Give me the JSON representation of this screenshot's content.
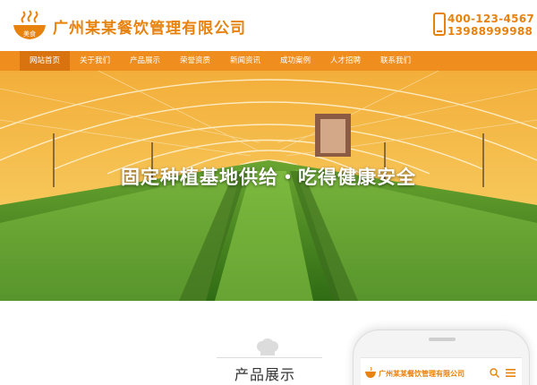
{
  "header": {
    "brand": "广州某某餐饮管理有限公司",
    "logo_caption": "美食",
    "phone": "400-123-4567",
    "mobile": "13988999988"
  },
  "nav": {
    "items": [
      {
        "label": "网站首页",
        "active": true
      },
      {
        "label": "关于我们",
        "active": false
      },
      {
        "label": "产品展示",
        "active": false
      },
      {
        "label": "荣誉资质",
        "active": false
      },
      {
        "label": "新闻资讯",
        "active": false
      },
      {
        "label": "成功案例",
        "active": false
      },
      {
        "label": "人才招聘",
        "active": false
      },
      {
        "label": "联系我们",
        "active": false
      }
    ]
  },
  "banner": {
    "slogan": "固定种植基地供给・吃得健康安全"
  },
  "products": {
    "title": "产品展示"
  },
  "mockup": {
    "brand": "广州某某餐饮管理有限公司"
  },
  "colors": {
    "accent": "#ef8d1f",
    "brand_text": "#e8820e"
  }
}
